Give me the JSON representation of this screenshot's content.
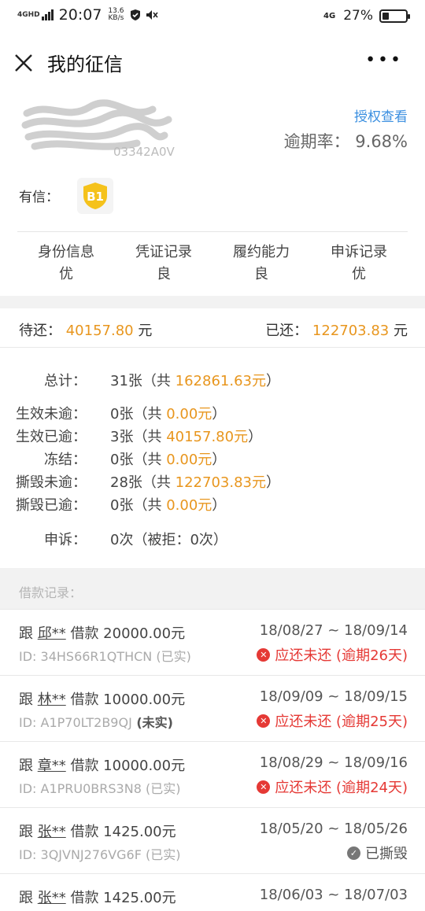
{
  "status_bar": {
    "network": "4GHD",
    "time": "20:07",
    "speed_value": "13.6",
    "speed_unit": "KB/s",
    "network_right": "4G",
    "battery_pct": "27%",
    "battery_level": 0.27
  },
  "nav": {
    "title": "我的征信",
    "more": "•••"
  },
  "profile": {
    "auth_link": "授权查看",
    "overdue_label": "逾期率：",
    "overdue_value": "9.68%",
    "credit_label": "有信：",
    "credit_badge": "B1",
    "id_partial": "03342A0V",
    "categories": [
      {
        "name": "身份信息",
        "grade": "优"
      },
      {
        "name": "凭证记录",
        "grade": "良"
      },
      {
        "name": "履约能力",
        "grade": "良"
      },
      {
        "name": "申诉记录",
        "grade": "优"
      }
    ]
  },
  "balances": {
    "pending_label": "待还：",
    "pending_value": "40157.80",
    "unit": "元",
    "paid_label": "已还：",
    "paid_value": "122703.83"
  },
  "stats": [
    {
      "label": "总计：",
      "count": "31张",
      "prefix": "（共 ",
      "amount": "162861.63元",
      "suffix": "）"
    },
    {
      "label": "生效未逾：",
      "count": "0张",
      "prefix": "（共 ",
      "amount": "0.00元",
      "suffix": "）"
    },
    {
      "label": "生效已逾：",
      "count": "3张",
      "prefix": "（共 ",
      "amount": "40157.80元",
      "suffix": "）"
    },
    {
      "label": "冻结：",
      "count": "0张",
      "prefix": "（共 ",
      "amount": "0.00元",
      "suffix": "）"
    },
    {
      "label": "撕毁未逾：",
      "count": "28张",
      "prefix": "（共 ",
      "amount": "122703.83元",
      "suffix": "）"
    },
    {
      "label": "撕毁已逾：",
      "count": "0张",
      "prefix": "（共 ",
      "amount": "0.00元",
      "suffix": "）"
    },
    {
      "label": "申诉：",
      "count": "0次",
      "prefix": "（被拒：",
      "amount": "0次",
      "suffix": "）"
    }
  ],
  "records_title": "借款记录：",
  "loans": [
    {
      "prefix": "跟 ",
      "name": "邱**",
      "desc": " 借款 20000.00元",
      "id_label": "ID: ",
      "id": "34HS66R1QTHCN",
      "real": " (已实)",
      "dates": "18/08/27 ~ 18/09/14",
      "status": "应还未还 (逾期26天)",
      "status_type": "overdue"
    },
    {
      "prefix": "跟 ",
      "name": "林**",
      "desc": " 借款 10000.00元",
      "id_label": "ID: ",
      "id": "A1P70LT2B9QJ",
      "real": " (未实)",
      "dates": "18/09/09 ~ 18/09/15",
      "status": "应还未还 (逾期25天)",
      "status_type": "overdue"
    },
    {
      "prefix": "跟 ",
      "name": "章**",
      "desc": " 借款 10000.00元",
      "id_label": "ID: ",
      "id": "A1PRU0BRS3N8",
      "real": " (已实)",
      "dates": "18/08/29 ~ 18/09/16",
      "status": "应还未还 (逾期24天)",
      "status_type": "overdue"
    },
    {
      "prefix": "跟 ",
      "name": "张**",
      "desc": " 借款 1425.00元",
      "id_label": "ID: ",
      "id": "3QJVNJ276VG6F",
      "real": " (已实)",
      "dates": "18/05/20 ~ 18/05/26",
      "status": "已撕毁",
      "status_type": "destroyed"
    },
    {
      "prefix": "跟 ",
      "name": "张**",
      "desc": " 借款 1425.00元",
      "id_label": "",
      "id": "",
      "real": "",
      "dates": "18/06/03 ~ 18/07/03",
      "status": "",
      "status_type": "none"
    }
  ]
}
